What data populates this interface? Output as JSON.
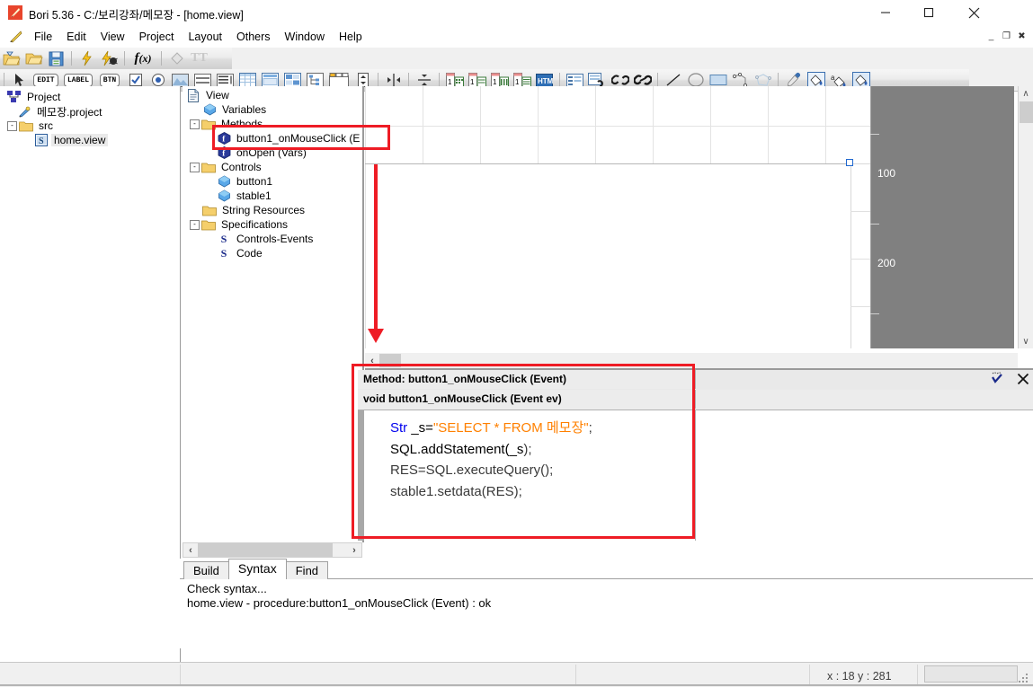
{
  "window": {
    "title": "Bori 5.36 - C:/보리강좌/메모장 - [home.view]",
    "app_icon": "feather-quill-icon",
    "controls": {
      "minimize": "minimize-icon",
      "maximize": "maximize-icon",
      "close": "close-icon"
    },
    "mdi_controls": {
      "minimize": "_",
      "restore": "❐",
      "close": "✖"
    }
  },
  "menubar": {
    "icon": "quill-icon",
    "items": [
      "File",
      "Edit",
      "View",
      "Project",
      "Layout",
      "Others",
      "Window",
      "Help"
    ]
  },
  "toolbar_row1": [
    {
      "name": "open-project-icon"
    },
    {
      "name": "open-folder-icon"
    },
    {
      "name": "save-icon"
    },
    {
      "name": "separator"
    },
    {
      "name": "build-run-icon"
    },
    {
      "name": "debug-icon"
    },
    {
      "name": "separator"
    },
    {
      "name": "function-fx-icon"
    },
    {
      "name": "separator"
    },
    {
      "name": "shape-icon"
    },
    {
      "name": "text-tt-icon"
    }
  ],
  "toolbar_row2": [
    {
      "name": "pointer-icon"
    },
    {
      "name": "edit-control-icon",
      "label": "EDIT"
    },
    {
      "name": "label-control-icon",
      "label": "LABEL"
    },
    {
      "name": "button-control-icon",
      "label": "BTN"
    },
    {
      "name": "checkbox-control-icon"
    },
    {
      "name": "radio-control-icon"
    },
    {
      "name": "image-control-icon"
    },
    {
      "name": "listbox-control-icon"
    },
    {
      "name": "listview-control-icon"
    },
    {
      "name": "grid-control-icon"
    },
    {
      "name": "table-control-icon"
    },
    {
      "name": "datagrid-control-icon"
    },
    {
      "name": "tree-control-icon"
    },
    {
      "name": "tab-control-icon"
    },
    {
      "name": "spin-control-icon"
    },
    {
      "name": "hsplit-control-icon"
    },
    {
      "name": "vsplit-control-icon"
    },
    {
      "name": "calendar-control-icon"
    },
    {
      "name": "calendar2-control-icon"
    },
    {
      "name": "calendar3-control-icon"
    },
    {
      "name": "calendar4-control-icon"
    },
    {
      "name": "html-control-icon",
      "label": "HTML"
    },
    {
      "name": "separator"
    },
    {
      "name": "property-list-icon"
    },
    {
      "name": "link-page-icon"
    },
    {
      "name": "link-icon"
    },
    {
      "name": "link2-icon"
    },
    {
      "name": "separator"
    },
    {
      "name": "line-tool-icon"
    },
    {
      "name": "ellipse-tool-icon"
    },
    {
      "name": "rectangle-tool-icon"
    },
    {
      "name": "polyline-tool-icon"
    },
    {
      "name": "polygon-tool-icon"
    },
    {
      "name": "separator"
    },
    {
      "name": "eyedropper-icon"
    },
    {
      "name": "fill-color-icon"
    },
    {
      "name": "fill-text-color-icon"
    },
    {
      "name": "fill-bg-color-icon"
    }
  ],
  "project_tree": {
    "root": {
      "label": "Project",
      "icon": "project-node-icon"
    },
    "nodes": [
      {
        "label": "메모장.project",
        "icon": "project-file-icon",
        "indent": 1,
        "expander": ""
      },
      {
        "label": "src",
        "icon": "folder-icon",
        "indent": 1,
        "expander": "-"
      },
      {
        "label": "home.view",
        "icon": "view-file-icon",
        "indent": 2,
        "expander": "",
        "selected": true
      }
    ]
  },
  "view_tree": {
    "root": {
      "label": "View",
      "icon": "document-icon"
    },
    "nodes": [
      {
        "label": "Variables",
        "icon": "variable-icon",
        "indent": 1,
        "expander": ""
      },
      {
        "label": "Methods",
        "icon": "folder-icon",
        "indent": 1,
        "expander": "-"
      },
      {
        "label": "button1_onMouseClick (E",
        "icon": "method-icon",
        "indent": 2,
        "expander": "",
        "highlighted": true
      },
      {
        "label": "onOpen (Vars)",
        "icon": "method-icon",
        "indent": 2,
        "expander": ""
      },
      {
        "label": "Controls",
        "icon": "folder-icon",
        "indent": 1,
        "expander": "-"
      },
      {
        "label": "button1",
        "icon": "control-icon",
        "indent": 2,
        "expander": ""
      },
      {
        "label": "stable1",
        "icon": "control-icon",
        "indent": 2,
        "expander": ""
      },
      {
        "label": "String Resources",
        "icon": "folder-icon",
        "indent": 1,
        "expander": ""
      },
      {
        "label": "Specifications",
        "icon": "folder-icon",
        "indent": 1,
        "expander": "-"
      },
      {
        "label": "Controls-Events",
        "icon": "spec-s-icon",
        "indent": 2,
        "expander": ""
      },
      {
        "label": "Code",
        "icon": "spec-s-icon",
        "indent": 2,
        "expander": ""
      }
    ]
  },
  "canvas": {
    "ruler_labels": [
      "100",
      "200"
    ],
    "selection_handle": "resize-handle",
    "hscroll_left_arrow": "‹",
    "hscroll_right_arrow": "›",
    "vscroll_up_arrow": "∧",
    "vscroll_down_arrow": "∨"
  },
  "method_editor": {
    "title": "Method: button1_onMouseClick (Event)",
    "signature": "void button1_onMouseClick (Event ev)",
    "check_icon": "syntax-check-icon",
    "close_icon": "close-icon",
    "code_lines": [
      [
        {
          "t": "Str ",
          "c": "kw"
        },
        {
          "t": "_s=",
          "c": "pl"
        },
        {
          "t": "\"SELECT * FROM 메모장\"",
          "c": "str"
        },
        {
          "t": ";",
          "c": "pn"
        }
      ],
      [
        {
          "t": "SQL.addStatement(_s",
          "c": "pl"
        },
        {
          "t": ");",
          "c": "pn"
        }
      ],
      [
        {
          "t": "RES=SQL.executeQuery();",
          "c": "pn"
        }
      ],
      [
        {
          "t": "stable1.setdata(RES);",
          "c": "pn"
        }
      ]
    ]
  },
  "output": {
    "tabs": [
      {
        "label": "Build",
        "active": false
      },
      {
        "label": "Syntax",
        "active": true
      },
      {
        "label": "Find",
        "active": false
      }
    ],
    "lines": [
      "Check syntax...",
      "home.view - procedure:button1_onMouseClick (Event) : ok"
    ]
  },
  "statusbar": {
    "coordinates": "x : 18  y : 281"
  },
  "colors": {
    "annotation": "#ee1c25",
    "keyword": "#0000ee",
    "string": "#ff8000",
    "gray_pane": "#808080",
    "selection_handle": "#2068cf"
  }
}
